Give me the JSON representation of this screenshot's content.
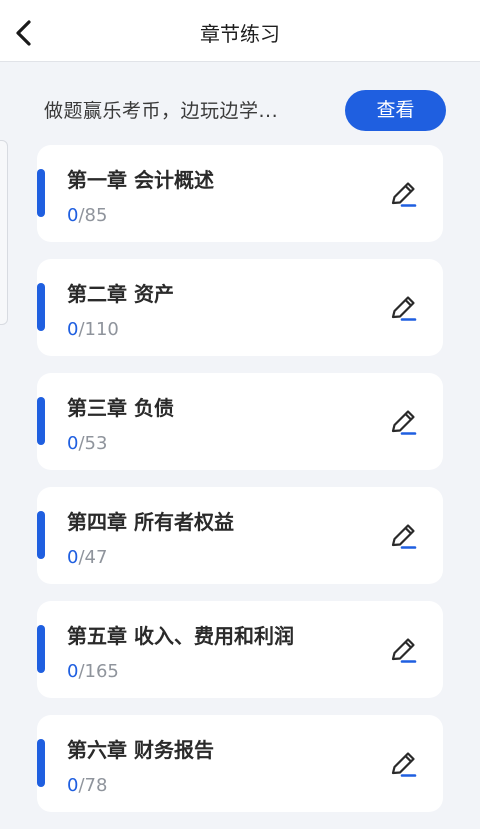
{
  "header": {
    "title": "章节练习"
  },
  "promo": {
    "text": "做题赢乐考币，边玩边学...",
    "button_label": "查看"
  },
  "chapters": [
    {
      "title": "第一章 会计概述",
      "done": "0",
      "total": "/85"
    },
    {
      "title": "第二章 资产",
      "done": "0",
      "total": "/110"
    },
    {
      "title": "第三章 负债",
      "done": "0",
      "total": "/53"
    },
    {
      "title": "第四章 所有者权益",
      "done": "0",
      "total": "/47"
    },
    {
      "title": "第五章 收入、费用和利润",
      "done": "0",
      "total": "/165"
    },
    {
      "title": "第六章 财务报告",
      "done": "0",
      "total": "/78"
    }
  ],
  "colors": {
    "accent": "#1f5fe0",
    "background": "#f2f4f8",
    "card": "#ffffff"
  },
  "icons": {
    "back": "chevron-left-icon",
    "edit": "pencil-edit-icon"
  }
}
